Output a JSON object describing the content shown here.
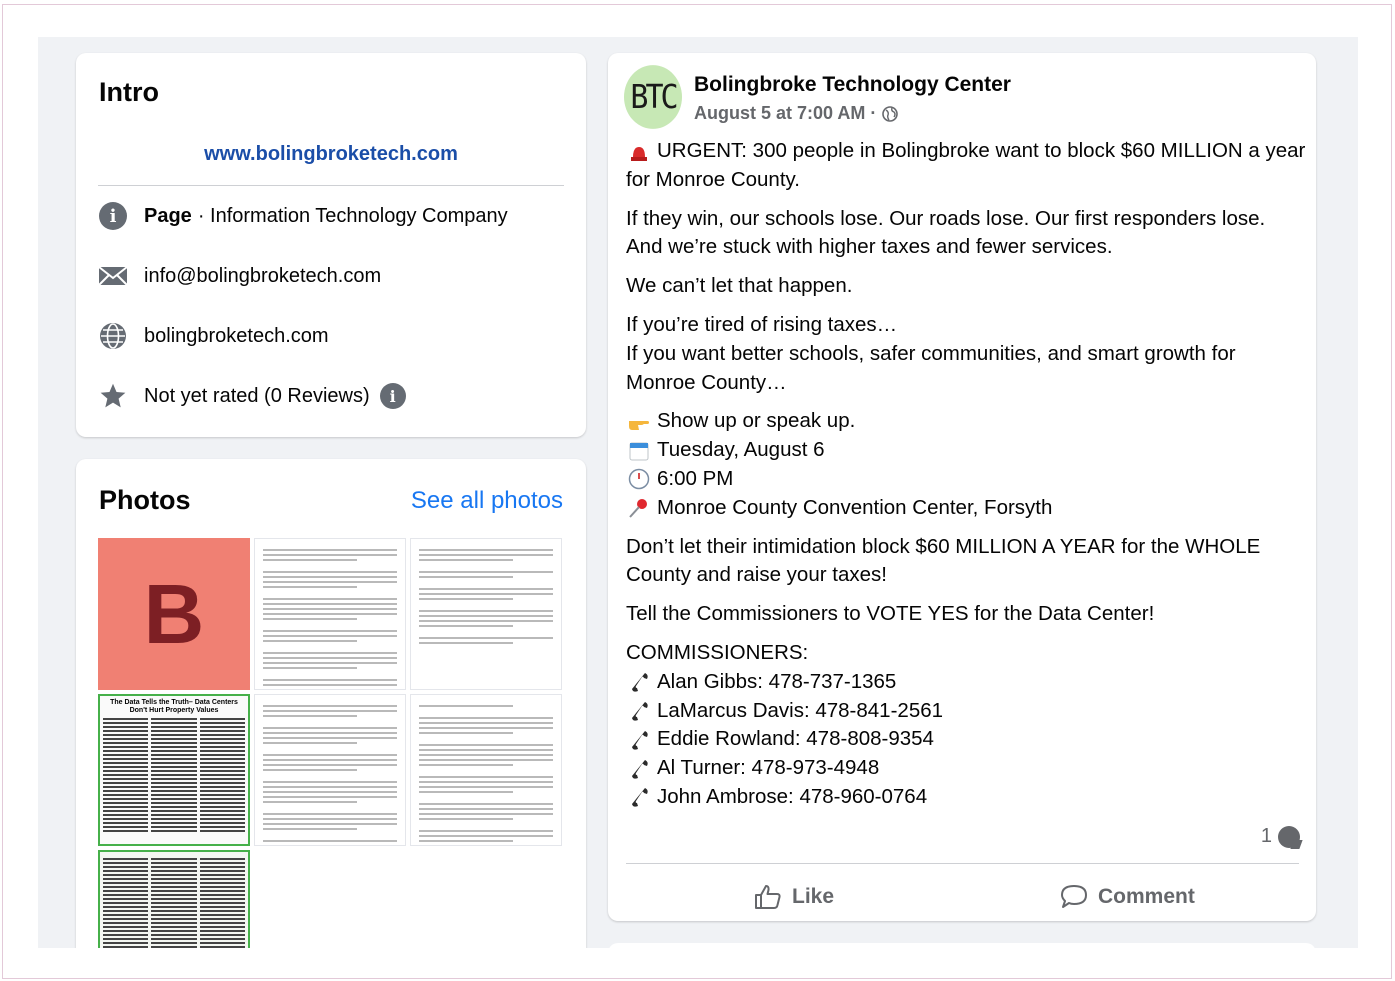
{
  "intro": {
    "title": "Intro",
    "website_link": "www.bolingbroketech.com",
    "page_label": "Page",
    "page_category": " · Information Technology Company",
    "email": "info@bolingbroketech.com",
    "website": "bolingbroketech.com",
    "rating": "Not yet rated (0 Reviews)"
  },
  "photos": {
    "title": "Photos",
    "see_all": "See all photos",
    "logo_letter": "B",
    "newsletter_headline": "The Data Tells the Truth– Data Centers Don't Hurt Property Values"
  },
  "post": {
    "avatar_text": "BTC",
    "author": "Bolingbroke Technology Center",
    "timestamp": "August 5 at 7:00 AM · ",
    "p1": "URGENT: 300 people in Bolingbroke want to block $60 MILLION a year for Monroe County.",
    "p2": "If they win, our schools lose. Our roads lose. Our first responders lose. And we’re stuck with higher taxes and fewer services.",
    "p3": "We can’t let that happen.",
    "p4a": "If you’re tired of rising taxes…",
    "p4b": "If you want better schools, safer communities, and smart growth for Monroe County…",
    "event": {
      "action": "Show up or speak up.",
      "date": "Tuesday, August 6",
      "time": "6:00 PM",
      "place": "Monroe County Convention Center, Forsyth"
    },
    "p6": "Don’t let their intimidation block $60 MILLION A YEAR for the WHOLE County and raise your taxes!",
    "p7": "Tell the Commissioners to VOTE YES for the Data Center!",
    "commissioners_label": "COMMISSIONERS:",
    "commissioners": [
      "Alan Gibbs: 478-737-1365",
      "LaMarcus Davis: 478-841-2561",
      "Eddie Rowland: 478-808-9354",
      "Al Turner: 478-973-4948",
      "John Ambrose: 478-960-0764"
    ],
    "comment_count": "1",
    "like_label": "Like",
    "comment_label": "Comment"
  },
  "colors": {
    "link": "#1b4ea8",
    "accent": "#1877f2",
    "logo_bg": "#f08073",
    "logo_letter": "#7d1f24",
    "avatar_bg": "#c7e8b5",
    "page_bg": "#f0f2f5"
  }
}
